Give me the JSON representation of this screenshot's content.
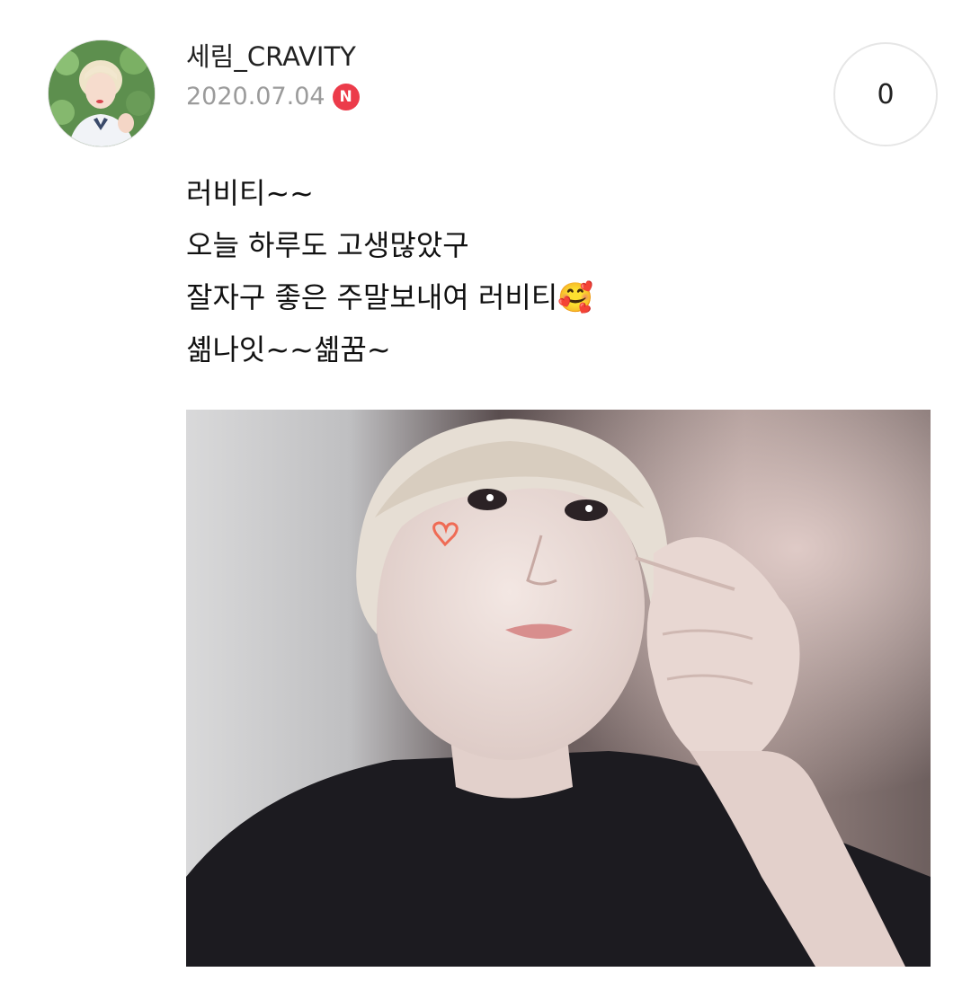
{
  "post": {
    "author": "세림_CRAVITY",
    "date": "2020.07.04",
    "new_badge": "N",
    "comment_count": "0",
    "message_lines": [
      "러비티~~",
      "오늘 하루도 고생많았구",
      "잘자구 좋은 주말보내여 러비티🥰",
      "셺나잇~~셺꿈~"
    ]
  },
  "icons": {
    "avatar": "profile-avatar",
    "badge": "new-post-badge"
  },
  "colors": {
    "badge_red": "#ec3b4a",
    "date_gray": "#9b9b9b",
    "circle_border": "#e6e6e6"
  }
}
